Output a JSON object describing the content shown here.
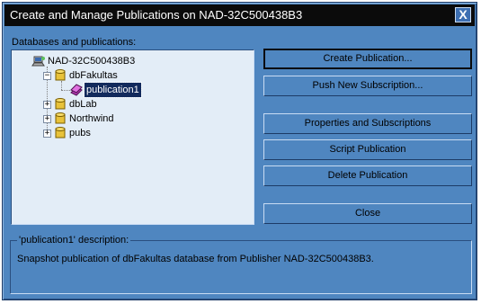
{
  "window": {
    "title": "Create and Manage Publications on NAD-32C500438B3",
    "close_glyph": "X"
  },
  "tree_label": "Databases and publications:",
  "tree": {
    "server": "NAD-32C500438B3",
    "databases": [
      {
        "name": "dbFakultas",
        "expanded": true,
        "publications": [
          "publication1"
        ]
      },
      {
        "name": "dbLab",
        "expanded": false
      },
      {
        "name": "Northwind",
        "expanded": false
      },
      {
        "name": "pubs",
        "expanded": false
      }
    ],
    "selected": "publication1"
  },
  "buttons": {
    "create": "Create Publication...",
    "push": "Push New Subscription...",
    "properties": "Properties and Subscriptions",
    "script": "Script Publication",
    "delete": "Delete Publication",
    "close": "Close"
  },
  "description": {
    "legend": "'publication1' description:",
    "text": "Snapshot publication of dbFakultas database from Publisher NAD-32C500438B3."
  },
  "colors": {
    "dialog_bg": "#4f86c0",
    "titlebar": "#0b0b0b",
    "tree_bg": "#e3edf7",
    "selection": "#122a5c"
  },
  "icons": {
    "server": "server-icon",
    "database": "database-icon",
    "publication": "publication-icon"
  }
}
